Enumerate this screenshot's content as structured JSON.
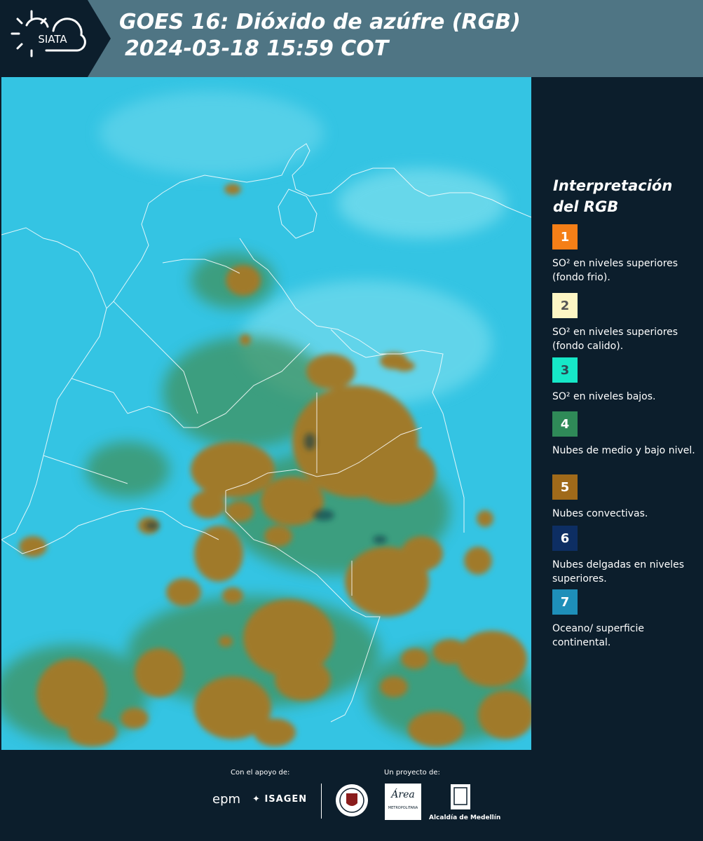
{
  "header": {
    "logo_text": "SIATA",
    "title_line1": "GOES 16: Dióxido de azúfre (RGB)",
    "title_line2": "2024-03-18 15:59 COT"
  },
  "map": {
    "product": "SO2 RGB",
    "background_color": "#33c4e4",
    "cloud_color": "#a07a2a",
    "green_cloud_color": "#3c8a58"
  },
  "legend": {
    "title": "Interpretación del RGB",
    "items": [
      {
        "number": "1",
        "color": "#f57f17",
        "text_color": "#ffffff",
        "label": "SO² en niveles superiores (fondo frio)."
      },
      {
        "number": "2",
        "color": "#fdf6c4",
        "text_color": "#555555",
        "label": "SO² en niveles superiores (fondo calido)."
      },
      {
        "number": "3",
        "color": "#16e8c8",
        "text_color": "#2c4a55",
        "label": "SO² en niveles bajos."
      },
      {
        "number": "4",
        "color": "#2f8a58",
        "text_color": "#ffffff",
        "label": "Nubes de medio y bajo nivel."
      },
      {
        "number": "5",
        "color": "#a06a1a",
        "text_color": "#ffffff",
        "label": "Nubes convectivas."
      },
      {
        "number": "6",
        "color": "#0d2e63",
        "text_color": "#ffffff",
        "label": "Nubes delgadas en niveles superiores."
      },
      {
        "number": "7",
        "color": "#1e8fb9",
        "text_color": "#ffffff",
        "label": "Oceano/ superficie continental."
      }
    ]
  },
  "footer": {
    "support_label": "Con el apoyo de:",
    "project_label": "Un proyecto de:",
    "epm_text": "epm",
    "isagen_text": "ISAGEN",
    "area_text": "Área",
    "area_subtext": "METROPOLITANA",
    "alcaldia_text": "Alcaldía de Medellín"
  }
}
